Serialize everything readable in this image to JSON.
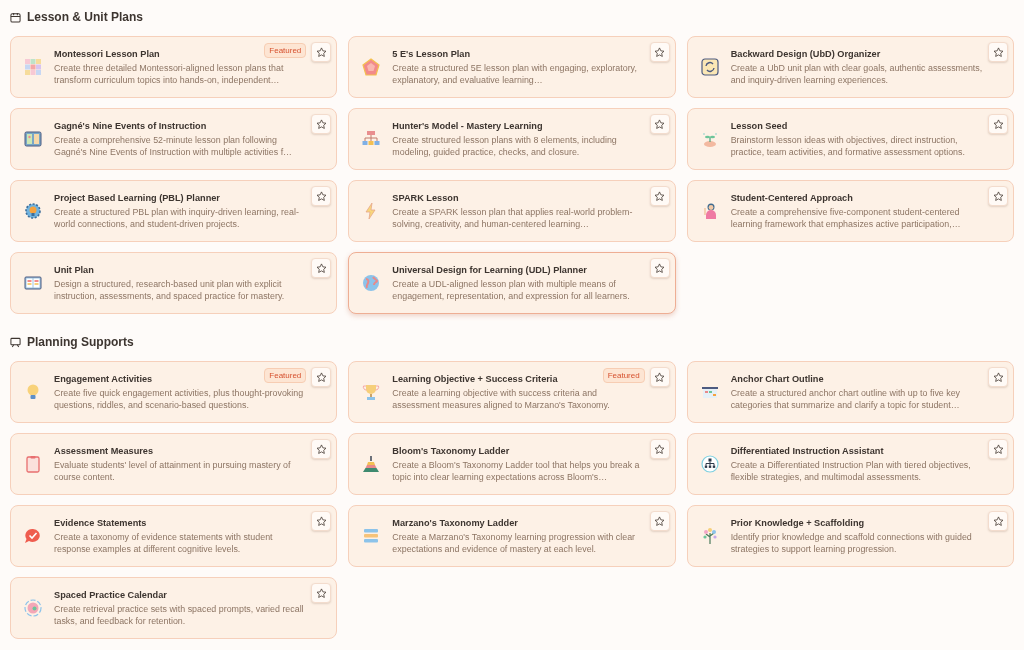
{
  "sections": [
    {
      "title": "Lesson & Unit Plans",
      "cards": [
        {
          "title": "Montessori Lesson Plan",
          "description": "Create three detailed Montessori-aligned lesson plans that transform curriculum topics into hands-on, independent…",
          "badge": "Featured",
          "hovered": false
        },
        {
          "title": "5 E's Lesson Plan",
          "description": "Create a structured 5E lesson plan with engaging, exploratory, explanatory, and evaluative learning…",
          "hovered": false
        },
        {
          "title": "Backward Design (UbD) Organizer",
          "description": "Create a UbD unit plan with clear goals, authentic assessments, and inquiry-driven learning experiences.",
          "hovered": false
        },
        {
          "title": "Gagné's Nine Events of Instruction",
          "description": "Create a comprehensive 52-minute lesson plan following Gagné's Nine Events of Instruction with multiple activities f…",
          "hovered": false
        },
        {
          "title": "Hunter's Model - Mastery Learning",
          "description": "Create structured lesson plans with 8 elements, including modeling, guided practice, checks, and closure.",
          "hovered": false
        },
        {
          "title": "Lesson Seed",
          "description": "Brainstorm lesson ideas with objectives, direct instruction, practice, team activities, and formative assessment options.",
          "hovered": false
        },
        {
          "title": "Project Based Learning (PBL) Planner",
          "description": "Create a structured PBL plan with inquiry-driven learning, real-world connections, and student-driven projects.",
          "hovered": false
        },
        {
          "title": "SPARK Lesson",
          "description": "Create a SPARK lesson plan that applies real-world problem-solving, creativity, and human-centered learning…",
          "hovered": false
        },
        {
          "title": "Student-Centered Approach",
          "description": "Create a comprehensive five-component student-centered learning framework that emphasizes active participation,…",
          "hovered": false
        },
        {
          "title": "Unit Plan",
          "description": "Design a structured, research-based unit plan with explicit instruction, assessments, and spaced practice for mastery.",
          "hovered": false
        },
        {
          "title": "Universal Design for Learning (UDL) Planner",
          "description": "Create a UDL-aligned lesson plan with multiple means of engagement, representation, and expression for all learners.",
          "hovered": true
        }
      ]
    },
    {
      "title": "Planning Supports",
      "cards": [
        {
          "title": "Engagement Activities",
          "description": "Create five quick engagement activities, plus thought-provoking questions, riddles, and scenario-based questions.",
          "badge": "Featured",
          "hovered": false
        },
        {
          "title": "Learning Objective + Success Criteria",
          "description": "Create a learning objective with success criteria and assessment measures aligned to Marzano's Taxonomy.",
          "badge": "Featured",
          "hovered": false
        },
        {
          "title": "Anchor Chart Outline",
          "description": "Create a structured anchor chart outline with up to five key categories that summarize and clarify a topic for student…",
          "hovered": false
        },
        {
          "title": "Assessment Measures",
          "description": "Evaluate students' level of attainment in pursuing mastery of course content.",
          "hovered": false
        },
        {
          "title": "Bloom's Taxonomy Ladder",
          "description": "Create a Bloom's Taxonomy Ladder tool that helps you break a topic into clear learning expectations across Bloom's…",
          "hovered": false
        },
        {
          "title": "Differentiated Instruction Assistant",
          "description": "Create a Differentiated Instruction Plan with tiered objectives, flexible strategies, and multimodal assessments.",
          "hovered": false
        },
        {
          "title": "Evidence Statements",
          "description": "Create a taxonomy of evidence statements with student response examples at different cognitive levels.",
          "hovered": false
        },
        {
          "title": "Marzano's Taxonomy Ladder",
          "description": "Create a Marzano's Taxonomy learning progression with clear expectations and evidence of mastery at each level.",
          "hovered": false
        },
        {
          "title": "Prior Knowledge + Scaffolding",
          "description": "Identify prior knowledge and scaffold connections with guided strategies to support learning progression.",
          "hovered": false
        },
        {
          "title": "Spaced Practice Calendar",
          "description": "Create retrieval practice sets with spaced prompts, varied recall tasks, and feedback for retention.",
          "hovered": false
        }
      ]
    }
  ]
}
